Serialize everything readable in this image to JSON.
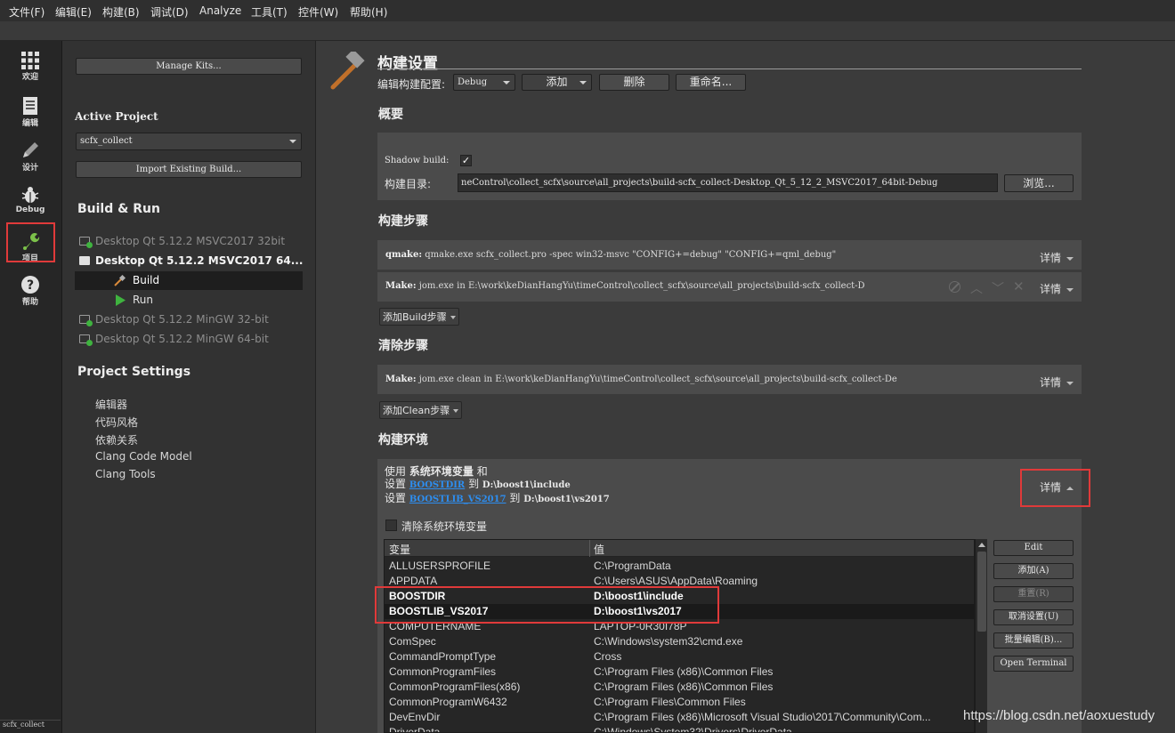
{
  "menu": [
    "文件(F)",
    "编辑(E)",
    "构建(B)",
    "调试(D)",
    "Analyze",
    "工具(T)",
    "控件(W)",
    "帮助(H)"
  ],
  "modes": [
    {
      "label": "欢迎",
      "icon": "grid-icon"
    },
    {
      "label": "编辑",
      "icon": "document-icon"
    },
    {
      "label": "设计",
      "icon": "pencil-icon"
    },
    {
      "label": "Debug",
      "icon": "bug-icon"
    },
    {
      "label": "项目",
      "icon": "wrench-icon"
    },
    {
      "label": "帮助",
      "icon": "help-icon"
    }
  ],
  "left": {
    "manage_kits": "Manage Kits...",
    "active_project_title": "Active Project",
    "project_select": "scfx_collect",
    "import_build": "Import Existing Build...",
    "build_run_title": "Build & Run",
    "kits": [
      "Desktop Qt 5.12.2 MSVC2017 32bit",
      "Desktop Qt 5.12.2 MSVC2017 64...",
      "Desktop Qt 5.12.2 MinGW 32-bit",
      "Desktop Qt 5.12.2 MinGW 64-bit"
    ],
    "build": "Build",
    "run": "Run",
    "project_settings_title": "Project Settings",
    "settings_items": [
      "编辑器",
      "代码风格",
      "依赖关系",
      "Clang Code Model",
      "Clang Tools"
    ],
    "bottom_tab": "scfx_collect"
  },
  "main": {
    "title": "构建设置",
    "edit_config_label": "编辑构建配置:",
    "config_select": "Debug",
    "add_btn": "添加",
    "delete_btn": "删除",
    "rename_btn": "重命名...",
    "overview_title": "概要",
    "shadow_build_label": "Shadow build:",
    "shadow_build_checked": true,
    "build_dir_label": "构建目录:",
    "build_dir_value": "neControl\\collect_scfx\\source\\all_projects\\build-scfx_collect-Desktop_Qt_5_12_2_MSVC2017_64bit-Debug",
    "browse_btn": "浏览...",
    "build_steps_title": "构建步骤",
    "step_qmake_name": "qmake:",
    "step_qmake_cmd": "qmake.exe scfx_collect.pro -spec win32-msvc \"CONFIG+=debug\" \"CONFIG+=qml_debug\"",
    "step_make_name": "Make:",
    "step_make_cmd": "jom.exe in E:\\work\\keDianHangYu\\timeControl\\collect_scfx\\source\\all_projects\\build-scfx_collect-D",
    "details": "详情",
    "add_build_step": "添加Build步骤",
    "clean_steps_title": "清除步骤",
    "clean_make_name": "Make:",
    "clean_make_cmd": "jom.exe clean in E:\\work\\keDianHangYu\\timeControl\\collect_scfx\\source\\all_projects\\build-scfx_collect-De",
    "add_clean_step": "添加Clean步骤",
    "env_title": "构建环境",
    "env_use": "使用",
    "env_sysvars": "系统环境变量",
    "env_and": "和",
    "env_set": "设置",
    "env_to": "到",
    "env_var1": "BOOSTDIR",
    "env_val1": "D:\\boost1\\include",
    "env_var2": "BOOSTLIB_VS2017",
    "env_val2": "D:\\boost1\\vs2017",
    "clear_sys_env": "清除系统环境变量",
    "table_headers": [
      "变量",
      "值"
    ],
    "table_rows": [
      [
        "ALLUSERSPROFILE",
        "C:\\ProgramData"
      ],
      [
        "APPDATA",
        "C:\\Users\\ASUS\\AppData\\Roaming"
      ],
      [
        "BOOSTDIR",
        "D:\\boost1\\include"
      ],
      [
        "BOOSTLIB_VS2017",
        "D:\\boost1\\vs2017"
      ],
      [
        "COMPUTERNAME",
        "LAPTOP-0R30I78P"
      ],
      [
        "ComSpec",
        "C:\\Windows\\system32\\cmd.exe"
      ],
      [
        "CommandPromptType",
        "Cross"
      ],
      [
        "CommonProgramFiles",
        "C:\\Program Files (x86)\\Common Files"
      ],
      [
        "CommonProgramFiles(x86)",
        "C:\\Program Files (x86)\\Common Files"
      ],
      [
        "CommonProgramW6432",
        "C:\\Program Files\\Common Files"
      ],
      [
        "DevEnvDir",
        "C:\\Program Files (x86)\\Microsoft Visual Studio\\2017\\Community\\Com..."
      ],
      [
        "DriverData",
        "C:\\Windows\\System32\\Drivers\\DriverData"
      ]
    ],
    "env_buttons": [
      "Edit",
      "添加(A)",
      "重置(R)",
      "取消设置(U)",
      "批量编辑(B)...",
      "Open Terminal"
    ]
  },
  "watermark": "https://blog.csdn.net/aoxuestudy",
  "colors": {
    "highlight_box": "#e03a3a",
    "link": "#2d8ef0",
    "run_green": "#3fb33f"
  }
}
